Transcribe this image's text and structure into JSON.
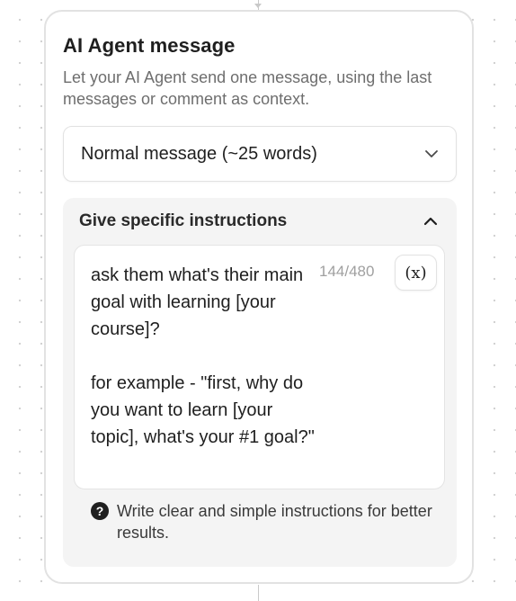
{
  "node": {
    "title": "AI Agent message",
    "description": "Let your AI Agent send one message, using the last messages or comment as context."
  },
  "message_length_select": {
    "value": "Normal message (~25 words)",
    "icon": "chevron-down-icon"
  },
  "instructions_section": {
    "title": "Give specific instructions",
    "toggle_icon": "chevron-up-icon",
    "text": "ask them what's their main goal with learning [your course]?\n\nfor example - \"first, why do you want to learn [your topic], what's your #1 goal?\"",
    "counter": "144/480",
    "variable_button_label": "(x)",
    "hint_icon": "question-circle-icon",
    "hint": "Write clear and simple instructions for better results."
  }
}
